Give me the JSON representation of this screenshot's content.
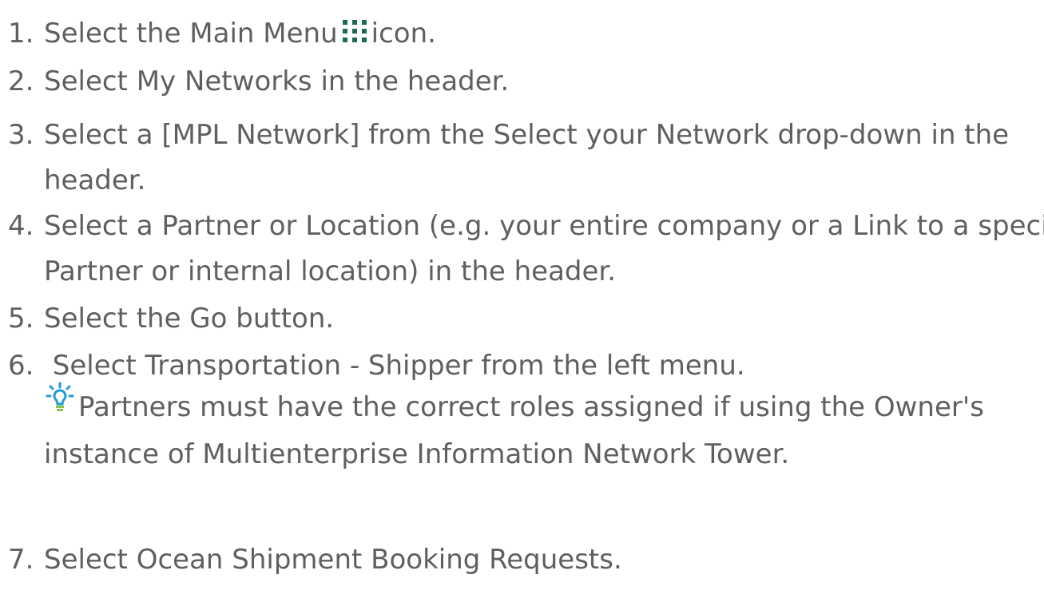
{
  "steps": [
    {
      "number": "1.",
      "before_icon": "Select the Main Menu",
      "icon": "grid-menu-icon",
      "after_icon": "icon."
    },
    {
      "number": "2.",
      "text": "Select My Networks in the header."
    },
    {
      "number": "3.",
      "line1": "Select a [MPL Network] from the Select your Network drop-down in the",
      "line2": "header."
    },
    {
      "number": "4.",
      "line1": "Select a Partner or Location (e.g. your entire company or a Link to a specific",
      "line2": "Partner or internal location) in the header."
    },
    {
      "number": "5.",
      "text": "Select the Go button."
    },
    {
      "number": "6.",
      "text": " Select Transportation - Shipper from the left menu."
    },
    {
      "number": "7.",
      "text": "Select Ocean Shipment Booking Requests."
    }
  ],
  "tip": {
    "icon": "lightbulb-icon",
    "line1": "Partners must have the correct roles assigned if using the Owner's",
    "line2": "instance of Multienterprise Information Network Tower."
  },
  "colors": {
    "text": "#5f5f5f",
    "menu_icon": "#1a6b4f",
    "tip_icon": "#1f9bd7"
  }
}
